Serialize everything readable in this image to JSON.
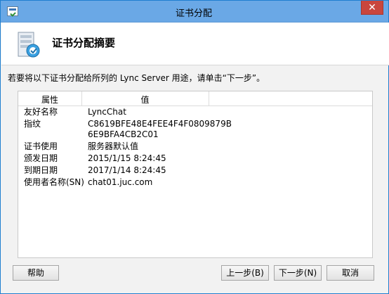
{
  "window": {
    "title": "证书分配",
    "close_glyph": "✕"
  },
  "header": {
    "title": "证书分配摘要",
    "icon": "server-certificate-icon"
  },
  "instruction": "若要将以下证书分配给所列的 Lync Server 用途，请单击“下一步”。",
  "list": {
    "columns": [
      "属性",
      "值"
    ],
    "rows": [
      {
        "property": "友好名称",
        "value": "LyncChat"
      },
      {
        "property": "指纹",
        "value": "C8619BFE48E4FEE4F4F0809879B",
        "value2": "6E9BFA4CB2C01"
      },
      {
        "property": "证书使用",
        "value": "服务器默认值"
      },
      {
        "property": "颁发日期",
        "value": "2015/1/15 8:24:45"
      },
      {
        "property": "到期日期",
        "value": "2017/1/14 8:24:45"
      },
      {
        "property": "使用者名称(SN)",
        "value": "chat01.juc.com"
      }
    ]
  },
  "buttons": {
    "help": "帮助",
    "back": "上一步(B)",
    "next": "下一步(N)",
    "cancel": "取消"
  },
  "colors": {
    "titlebar": "#6aa8e6",
    "close": "#c9463d"
  }
}
